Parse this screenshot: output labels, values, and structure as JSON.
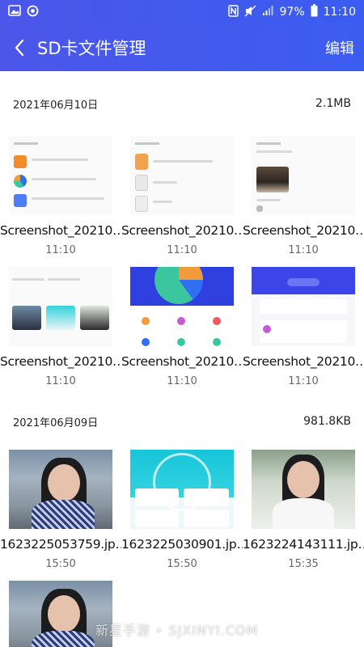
{
  "status_bar": {
    "battery": "97%",
    "time": "11:10"
  },
  "header": {
    "title": "SD卡文件管理",
    "edit_label": "编辑"
  },
  "sections": [
    {
      "date": "2021年06月10日",
      "size": "2.1MB",
      "items": [
        {
          "name": "Screenshot_20210…",
          "time": "11:10"
        },
        {
          "name": "Screenshot_20210…",
          "time": "11:10"
        },
        {
          "name": "Screenshot_20210…",
          "time": "11:10"
        },
        {
          "name": "Screenshot_20210…",
          "time": "11:10"
        },
        {
          "name": "Screenshot_20210…",
          "time": "11:10"
        },
        {
          "name": "Screenshot_20210…",
          "time": "11:10"
        }
      ]
    },
    {
      "date": "2021年06月09日",
      "size": "981.8KB",
      "items": [
        {
          "name": "1623225053759.jp…",
          "time": "15:50"
        },
        {
          "name": "1623225030901.jp…",
          "time": "15:50"
        },
        {
          "name": "1623224143111.jp…",
          "time": "15:35"
        },
        {
          "name": "",
          "time": ""
        }
      ]
    }
  ],
  "watermark": "新星手游 • SJXINYI.COM",
  "colors": {
    "header_bg": "#3f5aef",
    "pie_blue": "#2f6ff2",
    "pie_green": "#3cc6a0",
    "pie_orange": "#f39a3a"
  }
}
